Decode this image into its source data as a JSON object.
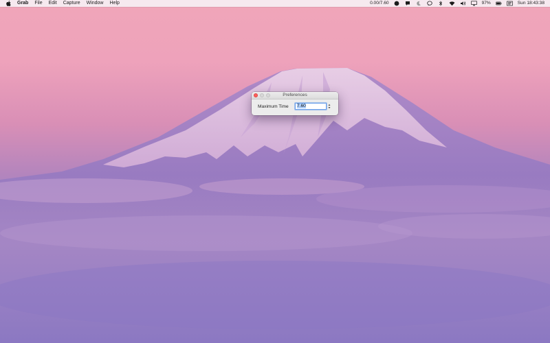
{
  "menubar": {
    "app_name": "Grab",
    "menus": [
      "File",
      "Edit",
      "Capture",
      "Window",
      "Help"
    ],
    "status_text": "0.00/7.60",
    "battery": "97%",
    "clock": "Sun 18:43:38",
    "icons": [
      "apple-icon",
      "record-icon",
      "chat-icon",
      "moon-icon",
      "message-icon",
      "bluetooth-icon",
      "wifi-icon",
      "volume-icon",
      "airplay-icon",
      "battery-icon",
      "display-icon"
    ]
  },
  "window": {
    "title": "Preferences",
    "field_label": "Maximum Time",
    "field_value": "7.60"
  }
}
